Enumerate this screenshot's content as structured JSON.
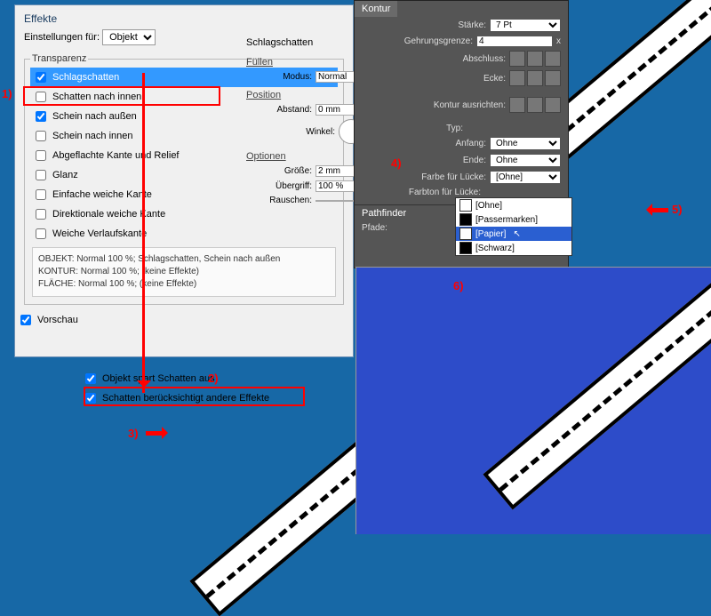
{
  "efx": {
    "title": "Effekte",
    "settings_label": "Einstellungen für:",
    "settings_value": "Objekt",
    "group": "Transparenz",
    "items": [
      {
        "label": "Schlagschatten",
        "checked": true,
        "hl": true
      },
      {
        "label": "Schatten nach innen",
        "checked": false
      },
      {
        "label": "Schein nach außen",
        "checked": true
      },
      {
        "label": "Schein nach innen",
        "checked": false
      },
      {
        "label": "Abgeflachte Kante und Relief",
        "checked": false
      },
      {
        "label": "Glanz",
        "checked": false
      },
      {
        "label": "Einfache weiche Kante",
        "checked": false
      },
      {
        "label": "Direktionale weiche Kante",
        "checked": false
      },
      {
        "label": "Weiche Verlaufskante",
        "checked": false
      }
    ],
    "info1": "OBJEKT: Normal 100 %; Schlagschatten, Schein nach außen",
    "info2": "KONTUR: Normal 100 %; (keine Effekte)",
    "info3": "FLÄCHE: Normal 100 %; (keine Effekte)",
    "preview": "Vorschau"
  },
  "shadow": {
    "title": "Schlagschatten",
    "sec1": "Füllen",
    "modus_l": "Modus:",
    "modus_v": "Normal",
    "sec2": "Position",
    "abstand_l": "Abstand:",
    "abstand_v": "0 mm",
    "winkel_l": "Winkel:",
    "sec3": "Optionen",
    "groesse_l": "Größe:",
    "groesse_v": "2 mm",
    "ueber_l": "Übergriff:",
    "ueber_v": "100 %",
    "rauschen_l": "Rauschen:"
  },
  "lower": {
    "c1": "Objekt spart Schatten aus",
    "c2": "Schatten berücksichtigt andere Effekte"
  },
  "kontur": {
    "tab": "Kontur",
    "staerke_l": "Stärke:",
    "staerke_v": "7 Pt",
    "gehr_l": "Gehrungsgrenze:",
    "gehr_v": "4",
    "gehr_x": "x",
    "abschluss_l": "Abschluss:",
    "ecke_l": "Ecke:",
    "ausr_l": "Kontur ausrichten:",
    "typ_l": "Typ:",
    "anfang_l": "Anfang:",
    "anfang_v": "Ohne",
    "ende_l": "Ende:",
    "ende_v": "Ohne",
    "farbe_l": "Farbe für Lücke:",
    "farbe_v": "[Ohne]",
    "farbton_l": "Farbton für Lücke:",
    "pathfinder": "Pathfinder",
    "pfade": "Pfade:"
  },
  "dd": {
    "i0": "[Ohne]",
    "i1": "[Passermarken]",
    "i2": "[Papier]",
    "i3": "[Schwarz]"
  },
  "ann": {
    "n1": "1)",
    "n2": "2)",
    "n3": "3)",
    "n4": "4)",
    "n5": "5)",
    "n6": "6)"
  }
}
